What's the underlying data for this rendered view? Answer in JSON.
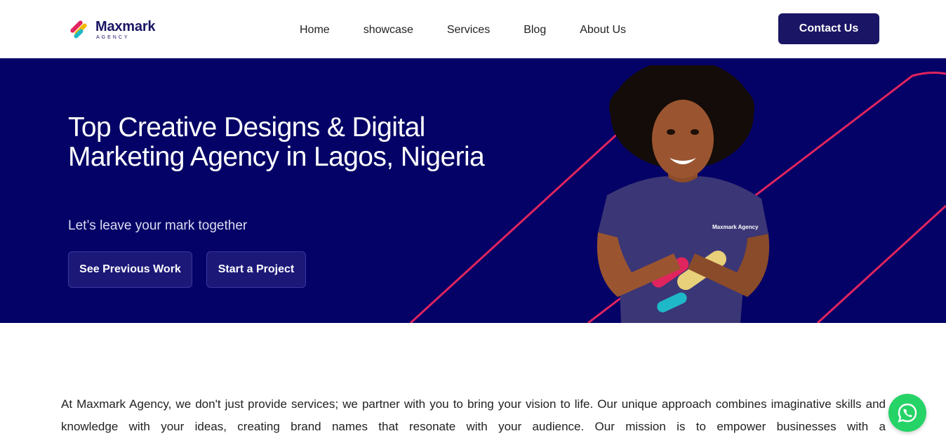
{
  "brand": {
    "name": "Maxmark",
    "tagline": "AGENCY",
    "colors": {
      "primary": "#1a1564",
      "hero_bg": "#040266",
      "accent_line": "#e0245e",
      "whatsapp": "#25d366"
    }
  },
  "nav": {
    "items": [
      "Home",
      "showcase",
      "Services",
      "Blog",
      "About Us"
    ],
    "contact_label": "Contact Us"
  },
  "hero": {
    "title": "Top Creative Designs & Digital Marketing Agency in Lagos, Nigeria",
    "subtitle": "Let’s leave your mark together",
    "primary_button": "See Previous Work",
    "secondary_button": "Start a Project",
    "shirt_text": "Maxmark Agency"
  },
  "intro": {
    "text": "At Maxmark Agency, we don't just provide services; we partner with you to bring your vision to life. Our unique approach combines imaginative skills and knowledge with your ideas, creating brand names that resonate with your audience. Our mission is to empower businesses with a"
  },
  "icons": {
    "chat": "whatsapp-icon",
    "logo": "maxmark-logo-mark"
  }
}
